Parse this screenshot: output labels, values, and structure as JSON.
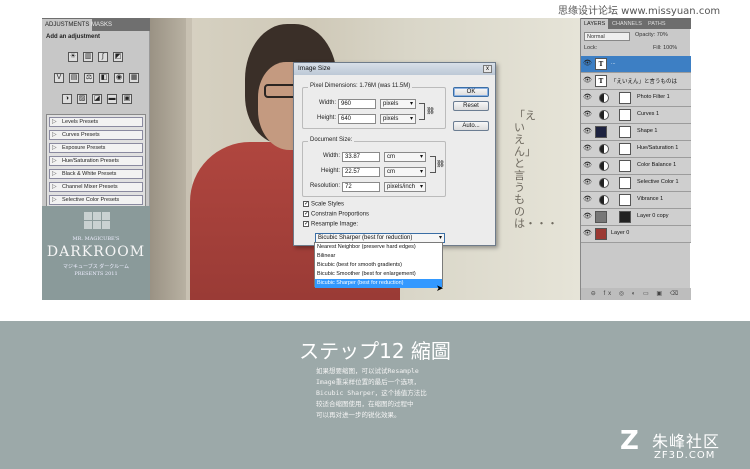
{
  "watermark_top": "思缘设计论坛 www.missyuan.com",
  "adjustments_panel": {
    "tabs": [
      "ADJUSTMENTS",
      "MASKS"
    ],
    "title": "Add an adjustment",
    "presets": [
      "Levels Presets",
      "Curves Presets",
      "Exposure Presets",
      "Hue/Saturation Presets",
      "Black & White Presets",
      "Channel Mixer Presets",
      "Selective Color Presets"
    ]
  },
  "darkroom": {
    "line1": "MR. MAGICUBE'S",
    "line2": "DARKROOM",
    "line3": "マジキューブス ダークルーム",
    "line4": "PRESENTS 2011"
  },
  "photo_vertical_text": "「えいえん」と言うものは・・・",
  "layers_panel": {
    "tabs": [
      "LAYERS",
      "CHANNELS",
      "PATHS"
    ],
    "blend_mode": "Normal",
    "opacity_label": "Opacity: 70%",
    "lock_label": "Lock:",
    "fill_label": "Fill: 100%",
    "footer_icons": "⊖ fx ◎ ◐ ▭ ▣ ⌫",
    "layers": [
      {
        "name": "...",
        "kind": "text",
        "selected": true
      },
      {
        "name": "「えいえん」と言うものは",
        "kind": "text",
        "selected": false
      },
      {
        "name": "Photo Filter 1",
        "kind": "adjustment",
        "selected": false
      },
      {
        "name": "Curves 1",
        "kind": "adjustment",
        "selected": false
      },
      {
        "name": "Shape 1",
        "kind": "shape",
        "selected": false
      },
      {
        "name": "Hue/Saturation 1",
        "kind": "adjustment",
        "selected": false
      },
      {
        "name": "Color Balance 1",
        "kind": "adjustment",
        "selected": false
      },
      {
        "name": "Selective Color 1",
        "kind": "adjustment",
        "selected": false
      },
      {
        "name": "Vibrance 1",
        "kind": "adjustment",
        "selected": false
      },
      {
        "name": "Layer 0 copy",
        "kind": "image",
        "selected": false
      },
      {
        "name": "Layer 0",
        "kind": "image",
        "selected": false
      }
    ]
  },
  "image_size_dialog": {
    "title": "Image Size",
    "close": "x",
    "pixel_dimensions": "Pixel Dimensions: 1.76M (was 11.5M)",
    "width_label": "Width:",
    "width_value": "960",
    "width_unit": "pixels",
    "height_label": "Height:",
    "height_value": "640",
    "height_unit": "pixels",
    "document_size": "Document Size:",
    "doc_width_label": "Width:",
    "doc_width_value": "33.87",
    "doc_width_unit": "cm",
    "doc_height_label": "Height:",
    "doc_height_value": "22.57",
    "doc_height_unit": "cm",
    "resolution_label": "Resolution:",
    "resolution_value": "72",
    "resolution_unit": "pixels/inch",
    "scale_styles": "Scale Styles",
    "constrain_proportions": "Constrain Proportions",
    "resample_image": "Resample Image:",
    "resample_value": "Bicubic Sharper (best for reduction)",
    "ok": "OK",
    "reset": "Reset",
    "auto": "Auto...",
    "dropdown_options": [
      "Nearest Neighbor (preserve hard edges)",
      "Bilinear",
      "Bicubic (best for smooth gradients)",
      "Bicubic Smoother (best for enlargement)",
      "Bicubic Sharper (best for reduction)"
    ],
    "highlighted_option": 4
  },
  "step_title": "ステップ12 縮圖",
  "description": [
    "如果想要缩图，可以试试Resample",
    "Image重采样位置的最后一个选项，",
    "Bicubic Sharper，这个插值方法比",
    "较适合缩图使用，在缩图的过程中",
    "可以再对进一步的锐化效果。"
  ],
  "logo": {
    "mark": "Z",
    "cn": "朱峰社区",
    "en": "ZF3D.COM"
  },
  "colors": {
    "band": "#9ca9a9",
    "highlight": "#3399ff",
    "layer_selected": "#3d7fc4"
  }
}
